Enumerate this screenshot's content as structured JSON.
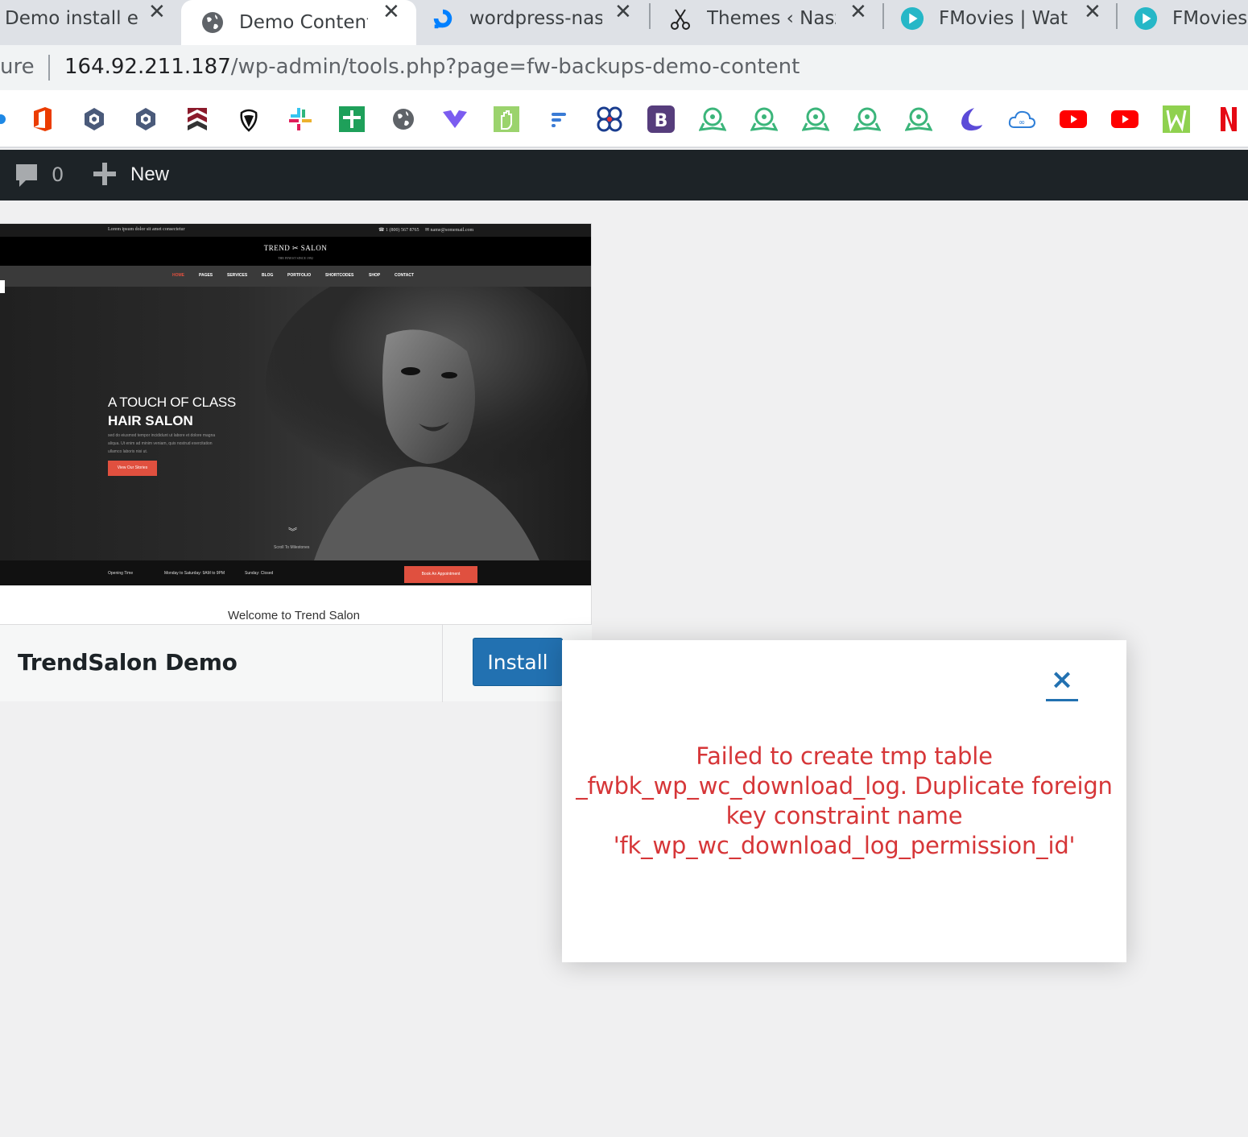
{
  "browser": {
    "tabs": [
      {
        "label": "Demo install er",
        "icon": "document-icon"
      },
      {
        "label": "Demo Content",
        "icon": "globe-icon"
      },
      {
        "label": "wordpress-nasz",
        "icon": "digitalocean-icon"
      },
      {
        "label": "Themes ‹ Nasz",
        "icon": "scissors-icon"
      },
      {
        "label": "FMovies | Watc",
        "icon": "play-icon"
      },
      {
        "label": "FMovies",
        "icon": "play-icon"
      }
    ],
    "close_glyph": "✕",
    "address": {
      "security": "ure",
      "host": "164.92.211.187",
      "path": "/wp-admin/tools.php?page=fw-backups-demo-content"
    },
    "bookmark_icons": [
      "office-icon",
      "hex-icon",
      "hex-icon",
      "chevron-shield-icon",
      "acorn-icon",
      "slack-icon",
      "plus-green-icon",
      "globe-icon",
      "heart-purple-icon",
      "hand-icon",
      "flow-icon",
      "knot-icon",
      "bootstrap-icon",
      "tracker-icon",
      "tracker-icon",
      "tracker-icon",
      "tracker-icon",
      "tracker-icon",
      "crescent-icon",
      "cloud-icon",
      "youtube-icon",
      "youtube-icon",
      "w-icon",
      "netflix-icon"
    ]
  },
  "adminbar": {
    "comment_count": "0",
    "new_label": "New"
  },
  "preview": {
    "top_left": "Lorem ipsum dolor sit amet consectetur",
    "top_phone": "☎ 1 (800) 567 8765",
    "top_email": "✉ name@somemail.com",
    "logo": "TREND ✂ SALON",
    "logo_sub": "THE FINEST SINCE 1992",
    "nav": [
      "HOME",
      "PAGES",
      "SERVICES",
      "BLOG",
      "PORTFOLIO",
      "SHORTCODES",
      "SHOP",
      "CONTACT"
    ],
    "tagline1": "A TOUCH OF CLASS",
    "tagline2": "HAIR SALON",
    "lorem": "sed do eiusmod tempor incididunt ut labore et dolore magna aliqua. Ut enim ad minim veniam, quis nostrud exercitation ullamco laboris nisi ut.",
    "btn": "View Our Stories",
    "scroll": "Scroll To Milestones",
    "opening": "Opening Time",
    "weekday": "Monday to Saturday: 9AM to 9PM",
    "sunday": "Sunday: Closed",
    "book": "Book An Appointment"
  },
  "card": {
    "welcome": "Welcome to Trend Salon",
    "theme_name": "TrendSalon Demo",
    "install_label": "Install"
  },
  "modal": {
    "close_glyph": "×",
    "error_line1": "Failed to create tmp table",
    "error_line2": "_fwbk_wp_wc_download_log. Duplicate foreign",
    "error_line3": "key constraint name",
    "error_line4": "'fk_wp_wc_download_log_permission_id'",
    "error_color": "#d63638"
  }
}
